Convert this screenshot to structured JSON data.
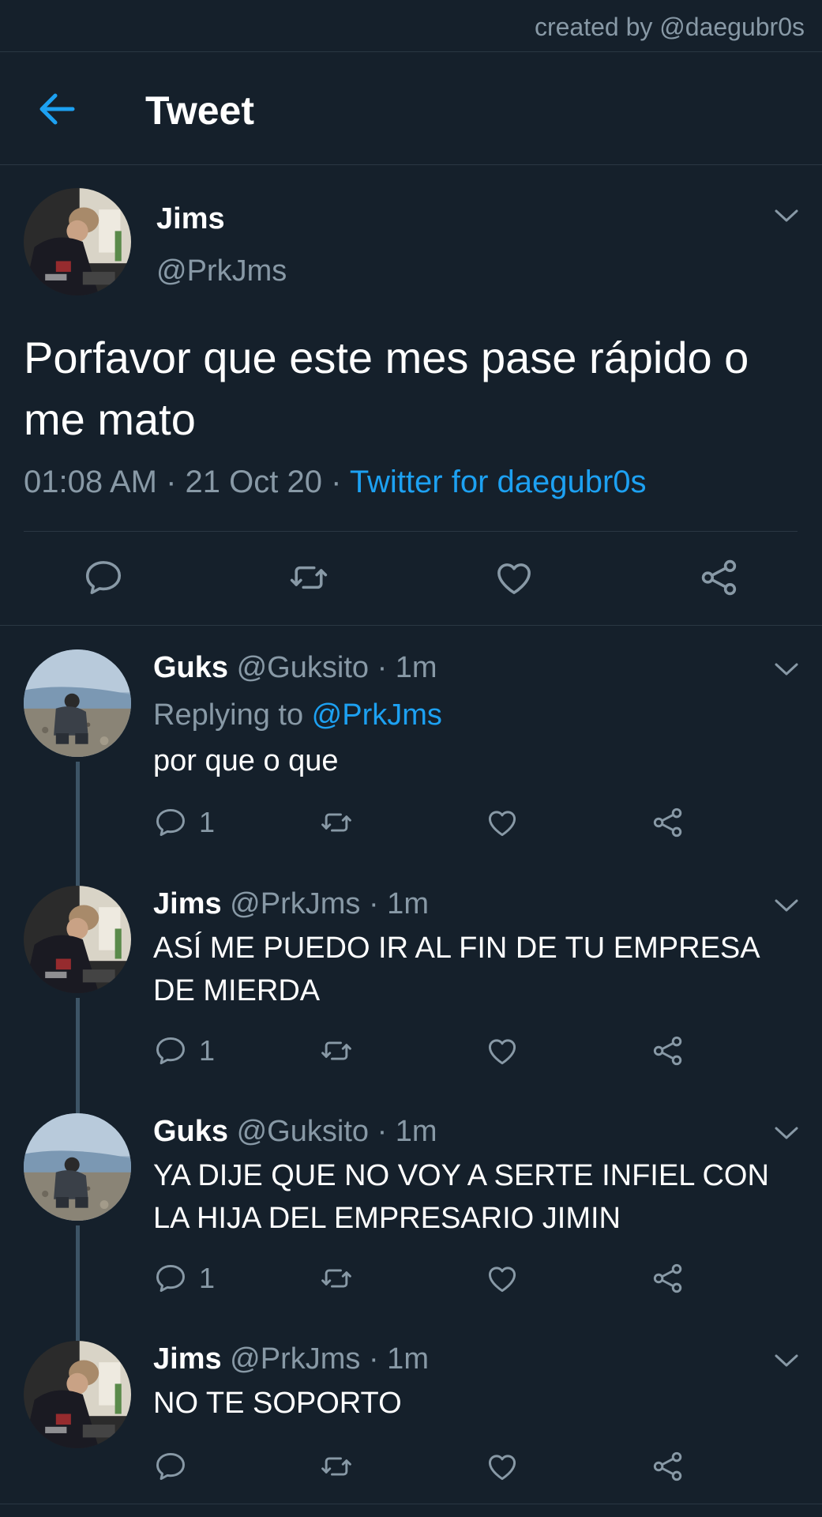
{
  "credit": "created by @daegubr0s",
  "header": {
    "title": "Tweet",
    "back_icon": "arrow-left-icon"
  },
  "colors": {
    "background": "#15202b",
    "accent": "#1da1f2",
    "muted": "#8899a6",
    "divider": "#2a3743"
  },
  "main_tweet": {
    "name": "Jims",
    "handle": "@PrkJms",
    "text": "Porfavor que este mes pase rápido o me mato",
    "time": "01:08 AM · 21 Oct 20 · ",
    "source": "Twitter for daegubr0s",
    "actions": [
      "reply-icon",
      "retweet-icon",
      "like-icon",
      "share-icon"
    ]
  },
  "replies": [
    {
      "name": "Guks",
      "meta": " @Guksito · 1m",
      "replying_prefix": "Replying to ",
      "replying_to": "@PrkJms",
      "text": "por que o que",
      "reply_count": "1"
    },
    {
      "name": "Jims",
      "meta": " @PrkJms · 1m",
      "text": "ASÍ ME PUEDO IR AL FIN DE TU EMPRESA DE MIERDA",
      "reply_count": "1"
    },
    {
      "name": "Guks",
      "meta": " @Guksito · 1m",
      "text": "YA DIJE QUE NO VOY A SERTE INFIEL CON LA HIJA DEL EMPRESARIO JIMIN",
      "reply_count": "1"
    },
    {
      "name": "Jims",
      "meta": " @PrkJms · 1m",
      "text": "NO TE SOPORTO",
      "reply_count": ""
    }
  ]
}
